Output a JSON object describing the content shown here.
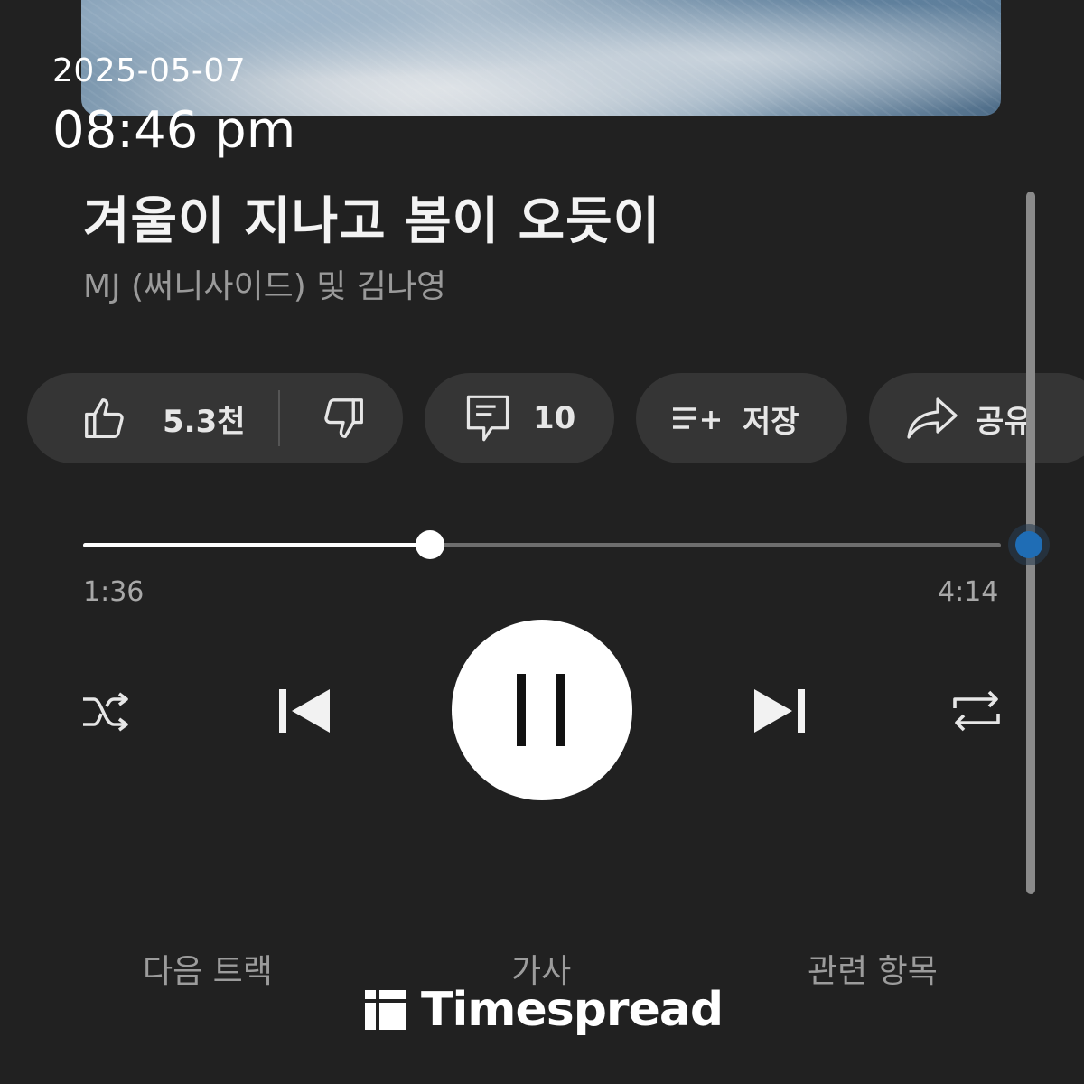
{
  "timestamp": {
    "date": "2025-05-07",
    "time": "08:46 pm"
  },
  "song": {
    "title": "겨울이 지나고 봄이 오듯이",
    "artist": "MJ (써니사이드) 및 김나영"
  },
  "actions": {
    "like_count": "5.3천",
    "comment_count": "10",
    "save_label": "저장",
    "share_label": "공유"
  },
  "playback": {
    "current_time": "1:36",
    "total_time": "4:14",
    "progress_fraction": 0.378
  },
  "bottom_tabs": [
    "다음 트랙",
    "가사",
    "관련 항목"
  ],
  "watermark": {
    "brand": "Timespread"
  },
  "icons": {
    "like": "thumbs-up-icon",
    "dislike": "thumbs-down-icon",
    "comment": "comment-icon",
    "save": "playlist-add-icon",
    "share": "share-arrow-icon",
    "shuffle": "shuffle-icon",
    "previous": "skip-previous-icon",
    "pause": "pause-icon",
    "next": "skip-next-icon",
    "repeat": "repeat-icon"
  },
  "colors": {
    "background": "#212121",
    "chip": "#353535",
    "accent_dot": "#1f6db5"
  }
}
